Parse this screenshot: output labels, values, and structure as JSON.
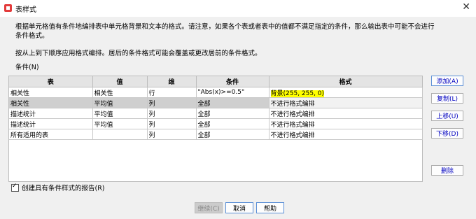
{
  "window": {
    "title": "表样式",
    "close_glyph": "✕"
  },
  "description_1": "根据单元格值有条件地编排表中单元格背景和文本的格式。请注意，如果各个表或者表中的值都不满足指定的条件，那么输出表中可能不会进行条件格式。",
  "description_2": "按从上到下顺序应用格式编排。居后的条件格式可能会覆盖或更改居前的条件格式。",
  "conditions_label": "条件(N)",
  "table": {
    "headers": [
      "表",
      "值",
      "维",
      "条件",
      "格式"
    ],
    "rows": [
      [
        "相关性",
        "相关性",
        "行",
        "\"Abs(x)>=0.5\"",
        "背景(255, 255, 0)"
      ],
      [
        "相关性",
        "平均值",
        "列",
        "全部",
        "不进行格式编排"
      ],
      [
        "描述统计",
        "平均值",
        "列",
        "全部",
        "不进行格式编排"
      ],
      [
        "描述统计",
        "平均值",
        "列",
        "全部",
        "不进行格式编排"
      ],
      [
        "所有适用的表",
        "",
        "列",
        "全部",
        "不进行格式编排"
      ]
    ],
    "highlight_color": "#ffff00"
  },
  "side_buttons": {
    "add": "添加(A)",
    "copy": "复制(L)",
    "up": "上移(U)",
    "down": "下移(D)",
    "delete": "删除"
  },
  "checkbox": {
    "label": "创建具有条件样式的报告(R)",
    "checked": true
  },
  "bottom_buttons": {
    "continue": "继续(C)",
    "cancel": "取消",
    "help": "帮助"
  }
}
